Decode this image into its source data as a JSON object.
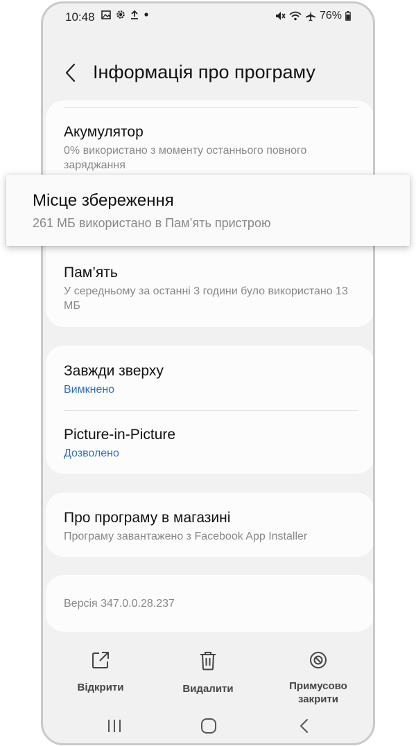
{
  "status": {
    "time": "10:48",
    "battery": "76%"
  },
  "header": {
    "title": "Інформація про програму"
  },
  "usage": {
    "battery_title": "Акумулятор",
    "battery_sub": "0% використано з моменту останнього повного заряджання",
    "storage_title": "Місце збереження",
    "storage_sub": "261 МБ використано в Пам’ять пристрою",
    "memory_title": "Пам’ять",
    "memory_sub": "У середньому за останні 3 години було використано 13 МБ"
  },
  "display": {
    "on_top_title": "Завжди зверху",
    "on_top_value": "Вимкнено",
    "pip_title": "Picture-in-Picture",
    "pip_value": "Дозволено"
  },
  "store": {
    "title": "Про програму в магазині",
    "sub": "Програму завантажено з Facebook App Installer"
  },
  "version": "Версія 347.0.0.28.237",
  "actions": {
    "open": "Відкрити",
    "uninstall": "Видалити",
    "force_stop": "Примусово закрити"
  },
  "icons": {
    "back": "chevron-left-icon",
    "open": "open-external-icon",
    "uninstall": "trash-icon",
    "force_stop": "block-icon"
  },
  "colors": {
    "accent": "#2f6ebf",
    "background": "#f1f1f1",
    "card": "#fcfcfc"
  }
}
